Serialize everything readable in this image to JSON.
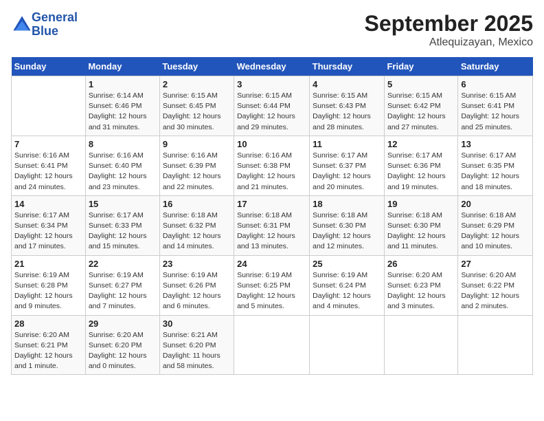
{
  "header": {
    "logo_line1": "General",
    "logo_line2": "Blue",
    "title": "September 2025",
    "subtitle": "Atlequizayan, Mexico"
  },
  "days_of_week": [
    "Sunday",
    "Monday",
    "Tuesday",
    "Wednesday",
    "Thursday",
    "Friday",
    "Saturday"
  ],
  "weeks": [
    [
      {
        "num": "",
        "info": ""
      },
      {
        "num": "1",
        "info": "Sunrise: 6:14 AM\nSunset: 6:46 PM\nDaylight: 12 hours\nand 31 minutes."
      },
      {
        "num": "2",
        "info": "Sunrise: 6:15 AM\nSunset: 6:45 PM\nDaylight: 12 hours\nand 30 minutes."
      },
      {
        "num": "3",
        "info": "Sunrise: 6:15 AM\nSunset: 6:44 PM\nDaylight: 12 hours\nand 29 minutes."
      },
      {
        "num": "4",
        "info": "Sunrise: 6:15 AM\nSunset: 6:43 PM\nDaylight: 12 hours\nand 28 minutes."
      },
      {
        "num": "5",
        "info": "Sunrise: 6:15 AM\nSunset: 6:42 PM\nDaylight: 12 hours\nand 27 minutes."
      },
      {
        "num": "6",
        "info": "Sunrise: 6:15 AM\nSunset: 6:41 PM\nDaylight: 12 hours\nand 25 minutes."
      }
    ],
    [
      {
        "num": "7",
        "info": "Sunrise: 6:16 AM\nSunset: 6:41 PM\nDaylight: 12 hours\nand 24 minutes."
      },
      {
        "num": "8",
        "info": "Sunrise: 6:16 AM\nSunset: 6:40 PM\nDaylight: 12 hours\nand 23 minutes."
      },
      {
        "num": "9",
        "info": "Sunrise: 6:16 AM\nSunset: 6:39 PM\nDaylight: 12 hours\nand 22 minutes."
      },
      {
        "num": "10",
        "info": "Sunrise: 6:16 AM\nSunset: 6:38 PM\nDaylight: 12 hours\nand 21 minutes."
      },
      {
        "num": "11",
        "info": "Sunrise: 6:17 AM\nSunset: 6:37 PM\nDaylight: 12 hours\nand 20 minutes."
      },
      {
        "num": "12",
        "info": "Sunrise: 6:17 AM\nSunset: 6:36 PM\nDaylight: 12 hours\nand 19 minutes."
      },
      {
        "num": "13",
        "info": "Sunrise: 6:17 AM\nSunset: 6:35 PM\nDaylight: 12 hours\nand 18 minutes."
      }
    ],
    [
      {
        "num": "14",
        "info": "Sunrise: 6:17 AM\nSunset: 6:34 PM\nDaylight: 12 hours\nand 17 minutes."
      },
      {
        "num": "15",
        "info": "Sunrise: 6:17 AM\nSunset: 6:33 PM\nDaylight: 12 hours\nand 15 minutes."
      },
      {
        "num": "16",
        "info": "Sunrise: 6:18 AM\nSunset: 6:32 PM\nDaylight: 12 hours\nand 14 minutes."
      },
      {
        "num": "17",
        "info": "Sunrise: 6:18 AM\nSunset: 6:31 PM\nDaylight: 12 hours\nand 13 minutes."
      },
      {
        "num": "18",
        "info": "Sunrise: 6:18 AM\nSunset: 6:30 PM\nDaylight: 12 hours\nand 12 minutes."
      },
      {
        "num": "19",
        "info": "Sunrise: 6:18 AM\nSunset: 6:30 PM\nDaylight: 12 hours\nand 11 minutes."
      },
      {
        "num": "20",
        "info": "Sunrise: 6:18 AM\nSunset: 6:29 PM\nDaylight: 12 hours\nand 10 minutes."
      }
    ],
    [
      {
        "num": "21",
        "info": "Sunrise: 6:19 AM\nSunset: 6:28 PM\nDaylight: 12 hours\nand 9 minutes."
      },
      {
        "num": "22",
        "info": "Sunrise: 6:19 AM\nSunset: 6:27 PM\nDaylight: 12 hours\nand 7 minutes."
      },
      {
        "num": "23",
        "info": "Sunrise: 6:19 AM\nSunset: 6:26 PM\nDaylight: 12 hours\nand 6 minutes."
      },
      {
        "num": "24",
        "info": "Sunrise: 6:19 AM\nSunset: 6:25 PM\nDaylight: 12 hours\nand 5 minutes."
      },
      {
        "num": "25",
        "info": "Sunrise: 6:19 AM\nSunset: 6:24 PM\nDaylight: 12 hours\nand 4 minutes."
      },
      {
        "num": "26",
        "info": "Sunrise: 6:20 AM\nSunset: 6:23 PM\nDaylight: 12 hours\nand 3 minutes."
      },
      {
        "num": "27",
        "info": "Sunrise: 6:20 AM\nSunset: 6:22 PM\nDaylight: 12 hours\nand 2 minutes."
      }
    ],
    [
      {
        "num": "28",
        "info": "Sunrise: 6:20 AM\nSunset: 6:21 PM\nDaylight: 12 hours\nand 1 minute."
      },
      {
        "num": "29",
        "info": "Sunrise: 6:20 AM\nSunset: 6:20 PM\nDaylight: 12 hours\nand 0 minutes."
      },
      {
        "num": "30",
        "info": "Sunrise: 6:21 AM\nSunset: 6:20 PM\nDaylight: 11 hours\nand 58 minutes."
      },
      {
        "num": "",
        "info": ""
      },
      {
        "num": "",
        "info": ""
      },
      {
        "num": "",
        "info": ""
      },
      {
        "num": "",
        "info": ""
      }
    ]
  ]
}
